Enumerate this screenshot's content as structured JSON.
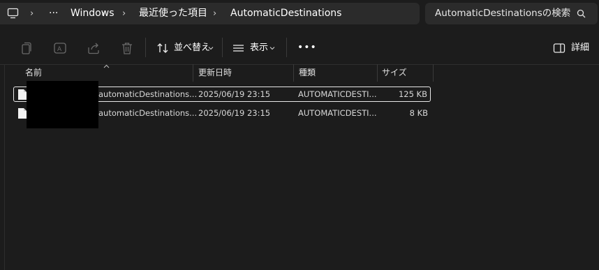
{
  "address_bar": {
    "overflow_label": "···",
    "crumbs": [
      "Windows",
      "最近使った項目",
      "AutomaticDestinations"
    ]
  },
  "search": {
    "placeholder": "AutomaticDestinationsの検索"
  },
  "toolbar": {
    "sort_label": "並べ替え",
    "view_label": "表示",
    "more_label": "•••",
    "details_label": "詳細"
  },
  "columns": {
    "name": "名前",
    "date": "更新日時",
    "type": "種類",
    "size": "サイズ"
  },
  "files": [
    {
      "name": "automaticDestinations...",
      "date": "2025/06/19 23:15",
      "type": "AUTOMATICDESTI...",
      "size": "125 KB"
    },
    {
      "name": "automaticDestinations...",
      "date": "2025/06/19 23:15",
      "type": "AUTOMATICDESTI...",
      "size": "8 KB"
    }
  ]
}
